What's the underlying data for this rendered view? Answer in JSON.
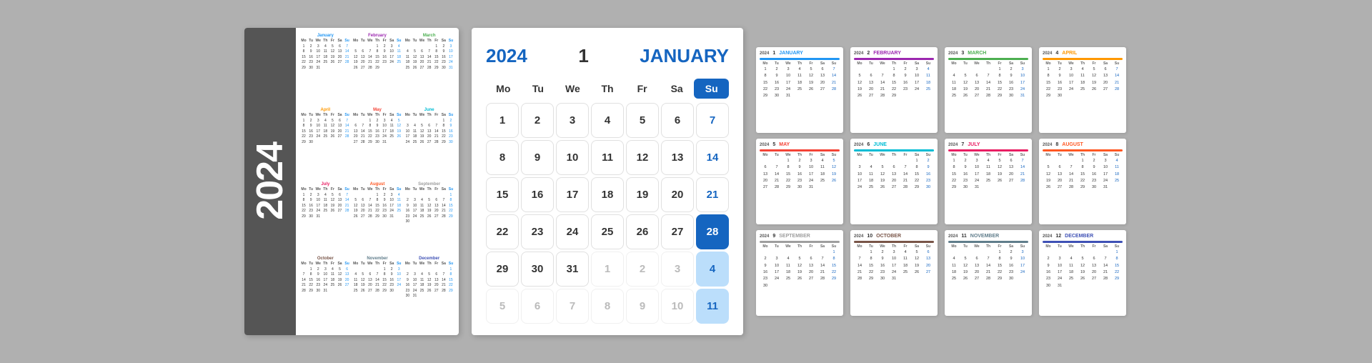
{
  "year": "2024",
  "leftPanel": {
    "yearDisplay": "2024",
    "months": [
      {
        "name": "January",
        "colorClass": "color-jan",
        "days": [
          "",
          "",
          "1",
          "2",
          "3",
          "4",
          "5",
          "6",
          "7",
          "8",
          "9",
          "10",
          "11",
          "12",
          "13",
          "14",
          "15",
          "16",
          "17",
          "18",
          "19",
          "20",
          "21",
          "22",
          "23",
          "24",
          "25",
          "26",
          "27",
          "28",
          "29",
          "30",
          "31",
          "",
          "",
          ""
        ]
      },
      {
        "name": "February",
        "colorClass": "color-feb",
        "days": [
          "",
          "",
          "",
          "",
          "1",
          "2",
          "3",
          "4",
          "5",
          "6",
          "7",
          "8",
          "9",
          "10",
          "11",
          "12",
          "13",
          "14",
          "15",
          "16",
          "17",
          "18",
          "19",
          "20",
          "21",
          "22",
          "23",
          "24",
          "25",
          "26",
          "27",
          "28",
          "29",
          "",
          ""
        ]
      },
      {
        "name": "March",
        "colorClass": "color-mar",
        "days": [
          "",
          "",
          "",
          "",
          "",
          "1",
          "2",
          "3",
          "4",
          "5",
          "6",
          "7",
          "8",
          "9",
          "10",
          "11",
          "12",
          "13",
          "14",
          "15",
          "16",
          "17",
          "18",
          "19",
          "20",
          "21",
          "22",
          "23",
          "24",
          "25",
          "26",
          "27",
          "28",
          "29",
          "30",
          "31"
        ]
      },
      {
        "name": "April",
        "colorClass": "color-apr",
        "days": [
          "1",
          "2",
          "3",
          "4",
          "5",
          "6",
          "7",
          "8",
          "9",
          "10",
          "11",
          "12",
          "13",
          "14",
          "15",
          "16",
          "17",
          "18",
          "19",
          "20",
          "21",
          "22",
          "23",
          "24",
          "25",
          "26",
          "27",
          "28",
          "29",
          "30",
          "",
          "",
          "",
          "",
          ""
        ]
      },
      {
        "name": "May",
        "colorClass": "color-may",
        "days": [
          "",
          "",
          "1",
          "2",
          "3",
          "4",
          "5",
          "6",
          "7",
          "8",
          "9",
          "10",
          "11",
          "12",
          "13",
          "14",
          "15",
          "16",
          "17",
          "18",
          "19",
          "20",
          "21",
          "22",
          "23",
          "24",
          "25",
          "26",
          "27",
          "28",
          "29",
          "30",
          "31",
          "",
          ""
        ]
      },
      {
        "name": "June",
        "colorClass": "color-jun",
        "days": [
          "",
          "",
          "",
          "",
          "",
          "",
          "1",
          "2",
          "3",
          "4",
          "5",
          "6",
          "7",
          "8",
          "9",
          "10",
          "11",
          "12",
          "13",
          "14",
          "15",
          "16",
          "17",
          "18",
          "19",
          "20",
          "21",
          "22",
          "23",
          "24",
          "25",
          "26",
          "27",
          "28",
          "29",
          "30"
        ]
      },
      {
        "name": "July",
        "colorClass": "color-jul",
        "days": [
          "1",
          "2",
          "3",
          "4",
          "5",
          "6",
          "7",
          "8",
          "9",
          "10",
          "11",
          "12",
          "13",
          "14",
          "15",
          "16",
          "17",
          "18",
          "19",
          "20",
          "21",
          "22",
          "23",
          "24",
          "25",
          "26",
          "27",
          "28",
          "29",
          "30",
          "31",
          "",
          "",
          "",
          ""
        ]
      },
      {
        "name": "August",
        "colorClass": "color-aug",
        "days": [
          "",
          "",
          "",
          "1",
          "2",
          "3",
          "4",
          "5",
          "6",
          "7",
          "8",
          "9",
          "10",
          "11",
          "12",
          "13",
          "14",
          "15",
          "16",
          "17",
          "18",
          "19",
          "20",
          "21",
          "22",
          "23",
          "24",
          "25",
          "26",
          "27",
          "28",
          "29",
          "30",
          "31",
          ""
        ]
      },
      {
        "name": "September",
        "colorClass": "color-sep",
        "days": [
          "",
          "",
          "",
          "",
          "",
          "",
          "1",
          "2",
          "3",
          "4",
          "5",
          "6",
          "7",
          "8",
          "9",
          "10",
          "11",
          "12",
          "13",
          "14",
          "15",
          "16",
          "17",
          "18",
          "19",
          "20",
          "21",
          "22",
          "23",
          "24",
          "25",
          "26",
          "27",
          "28",
          "29",
          "30"
        ]
      },
      {
        "name": "October",
        "colorClass": "color-oct",
        "days": [
          "",
          "1",
          "2",
          "3",
          "4",
          "5",
          "6",
          "7",
          "8",
          "9",
          "10",
          "11",
          "12",
          "13",
          "14",
          "15",
          "16",
          "17",
          "18",
          "19",
          "20",
          "21",
          "22",
          "23",
          "24",
          "25",
          "26",
          "27",
          "28",
          "29",
          "30",
          "31",
          "",
          "",
          ""
        ]
      },
      {
        "name": "November",
        "colorClass": "color-nov",
        "days": [
          "",
          "",
          "",
          "",
          "1",
          "2",
          "3",
          "4",
          "5",
          "6",
          "7",
          "8",
          "9",
          "10",
          "11",
          "12",
          "13",
          "14",
          "15",
          "16",
          "17",
          "18",
          "19",
          "20",
          "21",
          "22",
          "23",
          "24",
          "25",
          "26",
          "27",
          "28",
          "29",
          "30",
          ""
        ]
      },
      {
        "name": "December",
        "colorClass": "color-dec",
        "days": [
          "",
          "",
          "",
          "",
          "",
          "",
          "1",
          "2",
          "3",
          "4",
          "5",
          "6",
          "7",
          "8",
          "9",
          "10",
          "11",
          "12",
          "13",
          "14",
          "15",
          "16",
          "17",
          "18",
          "19",
          "20",
          "21",
          "22",
          "23",
          "24",
          "25",
          "26",
          "27",
          "28",
          "29",
          "30",
          "31"
        ]
      }
    ]
  },
  "centerPanel": {
    "year": "2024",
    "number": "1",
    "monthName": "JANUARY",
    "dayHeaders": [
      "Mo",
      "Tu",
      "We",
      "Th",
      "Fr",
      "Sa",
      "Su"
    ],
    "cells": [
      {
        "d": "1",
        "type": "normal"
      },
      {
        "d": "2",
        "type": "normal"
      },
      {
        "d": "3",
        "type": "normal"
      },
      {
        "d": "4",
        "type": "normal"
      },
      {
        "d": "5",
        "type": "normal"
      },
      {
        "d": "6",
        "type": "normal"
      },
      {
        "d": "7",
        "type": "sunday"
      },
      {
        "d": "8",
        "type": "normal"
      },
      {
        "d": "9",
        "type": "normal"
      },
      {
        "d": "10",
        "type": "normal"
      },
      {
        "d": "11",
        "type": "normal"
      },
      {
        "d": "12",
        "type": "normal"
      },
      {
        "d": "13",
        "type": "normal"
      },
      {
        "d": "14",
        "type": "sunday"
      },
      {
        "d": "15",
        "type": "normal"
      },
      {
        "d": "16",
        "type": "normal"
      },
      {
        "d": "17",
        "type": "normal"
      },
      {
        "d": "18",
        "type": "normal"
      },
      {
        "d": "19",
        "type": "normal"
      },
      {
        "d": "20",
        "type": "normal"
      },
      {
        "d": "21",
        "type": "sunday"
      },
      {
        "d": "22",
        "type": "normal"
      },
      {
        "d": "23",
        "type": "normal"
      },
      {
        "d": "24",
        "type": "normal"
      },
      {
        "d": "25",
        "type": "normal"
      },
      {
        "d": "26",
        "type": "normal"
      },
      {
        "d": "27",
        "type": "normal"
      },
      {
        "d": "28",
        "type": "highlight"
      },
      {
        "d": "29",
        "type": "normal"
      },
      {
        "d": "30",
        "type": "normal"
      },
      {
        "d": "31",
        "type": "normal"
      },
      {
        "d": "1",
        "type": "faded"
      },
      {
        "d": "2",
        "type": "faded"
      },
      {
        "d": "3",
        "type": "faded"
      },
      {
        "d": "4",
        "type": "light-blue"
      },
      {
        "d": "5",
        "type": "faded"
      },
      {
        "d": "6",
        "type": "faded"
      },
      {
        "d": "7",
        "type": "faded"
      },
      {
        "d": "8",
        "type": "faded"
      },
      {
        "d": "9",
        "type": "faded"
      },
      {
        "d": "10",
        "type": "faded"
      },
      {
        "d": "11",
        "type": "light-blue"
      }
    ]
  },
  "rightCards": [
    {
      "num": "1",
      "month": "JANUARY",
      "color": "#2196F3",
      "year": "2024",
      "barColor": "#2196F3"
    },
    {
      "num": "2",
      "month": "FEBRUARY",
      "color": "#9C27B0",
      "year": "2024",
      "barColor": "#9C27B0"
    },
    {
      "num": "3",
      "month": "MARCH",
      "color": "#4CAF50",
      "year": "2024",
      "barColor": "#4CAF50"
    },
    {
      "num": "4",
      "month": "APRIL",
      "color": "#FF9800",
      "year": "2024",
      "barColor": "#FF9800"
    },
    {
      "num": "5",
      "month": "MAY",
      "color": "#F44336",
      "year": "2024",
      "barColor": "#F44336"
    },
    {
      "num": "6",
      "month": "JUNE",
      "color": "#00BCD4",
      "year": "2024",
      "barColor": "#00BCD4"
    },
    {
      "num": "7",
      "month": "JULY",
      "color": "#E91E63",
      "year": "2024",
      "barColor": "#E91E63"
    },
    {
      "num": "8",
      "month": "AUGUST",
      "color": "#FF5722",
      "year": "2024",
      "barColor": "#FF5722"
    },
    {
      "num": "9",
      "month": "SEPTEMBER",
      "color": "#9E9E9E",
      "year": "2024",
      "barColor": "#9E9E9E"
    },
    {
      "num": "10",
      "month": "OCTOBER",
      "color": "#795548",
      "year": "2024",
      "barColor": "#795548"
    },
    {
      "num": "11",
      "month": "NOVEMBER",
      "color": "#607D8B",
      "year": "2024",
      "barColor": "#607D8B"
    },
    {
      "num": "12",
      "month": "DECEMBER",
      "color": "#3F51B5",
      "year": "2024",
      "barColor": "#3F51B5"
    }
  ]
}
